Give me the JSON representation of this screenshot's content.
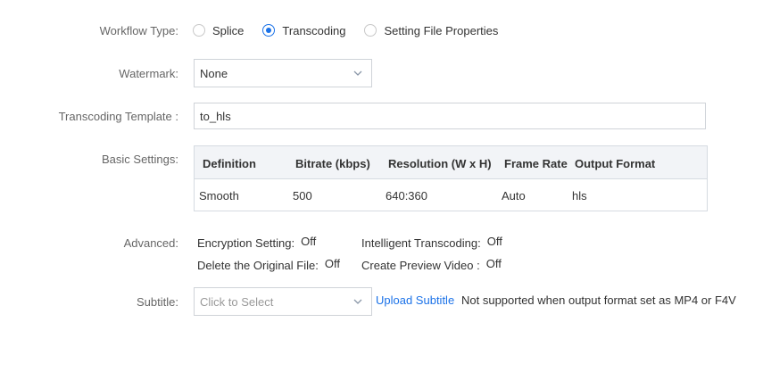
{
  "workflow": {
    "label": "Workflow Type:",
    "options": [
      {
        "label": "Splice",
        "checked": false
      },
      {
        "label": "Transcoding",
        "checked": true
      },
      {
        "label": "Setting File Properties",
        "checked": false
      }
    ]
  },
  "watermark": {
    "label": "Watermark:",
    "value": "None"
  },
  "template": {
    "label": "Transcoding Template :",
    "value": "to_hls"
  },
  "basic": {
    "label": "Basic Settings:",
    "headers": [
      "Definition",
      "Bitrate (kbps)",
      "Resolution (W x H)",
      "Frame Rate",
      "Output Format"
    ],
    "rows": [
      [
        "Smooth",
        "500",
        "640:360",
        "Auto",
        "hls"
      ]
    ]
  },
  "advanced": {
    "label": "Advanced:",
    "encryption": {
      "label": "Encryption Setting:",
      "value": "Off"
    },
    "intelligent": {
      "label": "Intelligent Transcoding:",
      "value": "Off"
    },
    "delete_original": {
      "label": "Delete the Original File:",
      "value": "Off"
    },
    "preview": {
      "label": "Create Preview Video :",
      "value": "Off"
    }
  },
  "subtitle": {
    "label": "Subtitle:",
    "placeholder": "Click to Select",
    "upload_label": "Upload Subtitle",
    "note": "Not supported when output format set as MP4 or F4V"
  },
  "colors": {
    "accent": "#1b72e8",
    "label": "#666666",
    "border": "#cfd3d8",
    "header_bg": "#f2f4f7"
  }
}
